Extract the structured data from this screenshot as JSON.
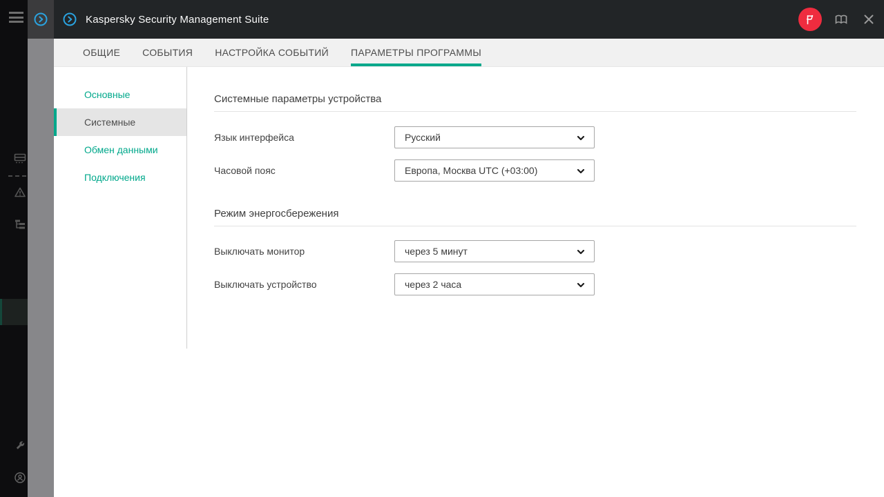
{
  "window": {
    "title": "Kaspersky Security Management Suite"
  },
  "colors": {
    "accent": "#00a88b",
    "header_bg": "#222527",
    "badge_red": "#ef2c3f",
    "rail_bg": "#0d0d0f",
    "strip_gray": "#87878a"
  },
  "header": {
    "icons": {
      "menu": "hamburger-icon",
      "app": "circled-arrow-icon",
      "notifications": "flag-badge-icon",
      "help": "open-book-icon",
      "close": "close-icon"
    }
  },
  "tabs": {
    "items": [
      {
        "label": "ОБЩИЕ",
        "active": false
      },
      {
        "label": "СОБЫТИЯ",
        "active": false
      },
      {
        "label": "НАСТРОЙКА СОБЫТИЙ",
        "active": false
      },
      {
        "label": "ПАРАМЕТРЫ ПРОГРАММЫ",
        "active": true
      }
    ]
  },
  "sidebar": {
    "items": [
      {
        "label": "Основные",
        "selected": false
      },
      {
        "label": "Системные",
        "selected": true
      },
      {
        "label": "Обмен данными",
        "selected": false
      },
      {
        "label": "Подключения",
        "selected": false
      }
    ]
  },
  "rail": {
    "icons": [
      "devices-icon",
      "warning-icon",
      "tree-icon",
      "wrench-icon",
      "user-icon"
    ]
  },
  "settings": {
    "sections": [
      {
        "title": "Системные параметры устройства",
        "fields": [
          {
            "label": "Язык интерфейса",
            "value": "Русский"
          },
          {
            "label": "Часовой пояс",
            "value": "Европа, Москва UTC (+03:00)"
          }
        ]
      },
      {
        "title": "Режим энергосбережения",
        "fields": [
          {
            "label": "Выключать монитор",
            "value": "через 5 минут"
          },
          {
            "label": "Выключать устройство",
            "value": "через 2 часа"
          }
        ]
      }
    ]
  }
}
